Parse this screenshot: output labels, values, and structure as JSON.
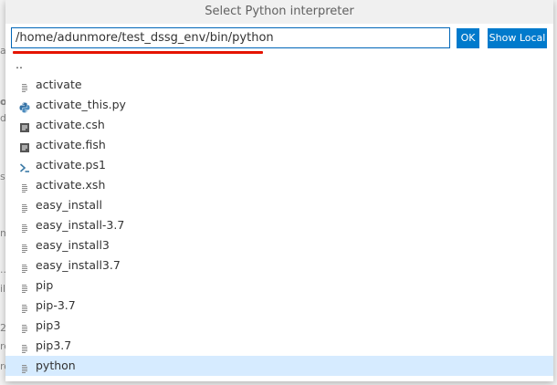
{
  "dialog": {
    "title": "Select Python interpreter",
    "path_value": "/home/adunmore/test_dssg_env/bin/python",
    "ok_label": "OK",
    "show_local_label": "Show Local"
  },
  "background": {
    "glyphs": [
      "a",
      "o",
      "d",
      "s",
      "m",
      "...",
      "il",
      "2",
      "rc",
      "ro"
    ]
  },
  "files": [
    {
      "name": "..",
      "icon": "none"
    },
    {
      "name": "activate",
      "icon": "file-lines-icon"
    },
    {
      "name": "activate_this.py",
      "icon": "python-icon"
    },
    {
      "name": "activate.csh",
      "icon": "shell-script-icon"
    },
    {
      "name": "activate.fish",
      "icon": "shell-script-icon"
    },
    {
      "name": "activate.ps1",
      "icon": "powershell-icon"
    },
    {
      "name": "activate.xsh",
      "icon": "file-lines-icon"
    },
    {
      "name": "easy_install",
      "icon": "file-lines-icon"
    },
    {
      "name": "easy_install-3.7",
      "icon": "file-lines-icon"
    },
    {
      "name": "easy_install3",
      "icon": "file-lines-icon"
    },
    {
      "name": "easy_install3.7",
      "icon": "file-lines-icon"
    },
    {
      "name": "pip",
      "icon": "file-lines-icon"
    },
    {
      "name": "pip-3.7",
      "icon": "file-lines-icon"
    },
    {
      "name": "pip3",
      "icon": "file-lines-icon"
    },
    {
      "name": "pip3.7",
      "icon": "file-lines-icon"
    },
    {
      "name": "python",
      "icon": "file-lines-icon",
      "selected": true
    }
  ],
  "colors": {
    "accent": "#007acc",
    "selection": "#d6ebff",
    "underline": "#e51400",
    "python_blue": "#3572a5",
    "shell_dark": "#555555",
    "powershell": "#3b7aa6"
  }
}
